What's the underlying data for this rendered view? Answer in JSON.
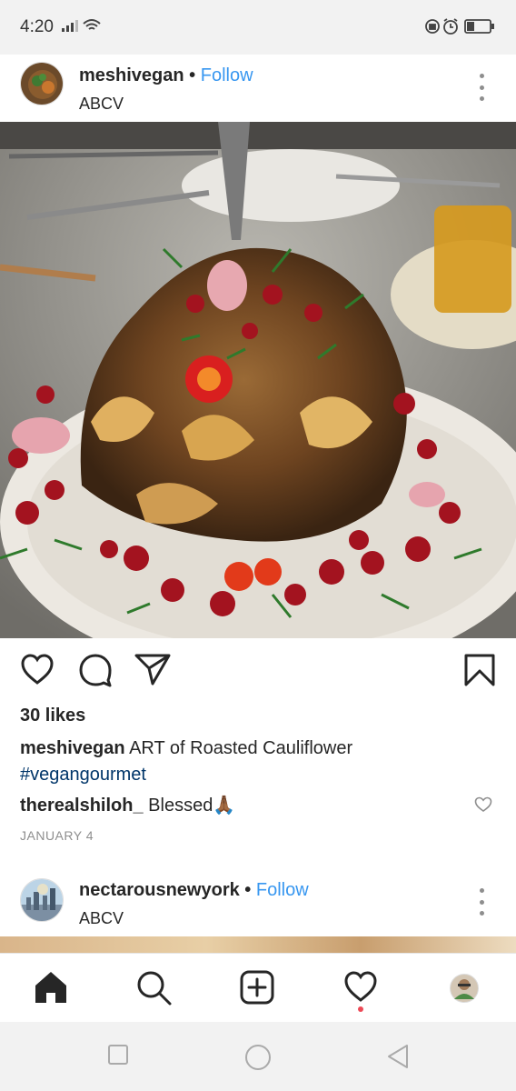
{
  "status_bar": {
    "time": "4:20",
    "icons_left": [
      "signal-icon",
      "wifi-icon"
    ],
    "icons_right": [
      "lock-rotation-icon",
      "alarm-icon",
      "battery-icon"
    ]
  },
  "post1": {
    "username": "meshivegan",
    "separator": "•",
    "follow_label": "Follow",
    "location": "ABCV",
    "likes": "30 likes",
    "caption_username": "meshivegan",
    "caption_text": "ART of Roasted Cauliflower",
    "caption_hashtag": "#vegangourmet",
    "comment_username": "therealshiloh_",
    "comment_text": "Blessed🙏🏾",
    "date": "JANUARY 4"
  },
  "post2": {
    "username": "nectarousnewyork",
    "separator": "•",
    "follow_label": "Follow",
    "location": "ABCV"
  },
  "bottom_nav": [
    "home-icon",
    "search-icon",
    "new-post-icon",
    "activity-heart-icon",
    "profile-avatar"
  ],
  "colors": {
    "follow_blue": "#3897f0",
    "hashtag_blue": "#003569",
    "notification_red": "#ed4956",
    "muted_gray": "#8e8e8e"
  }
}
